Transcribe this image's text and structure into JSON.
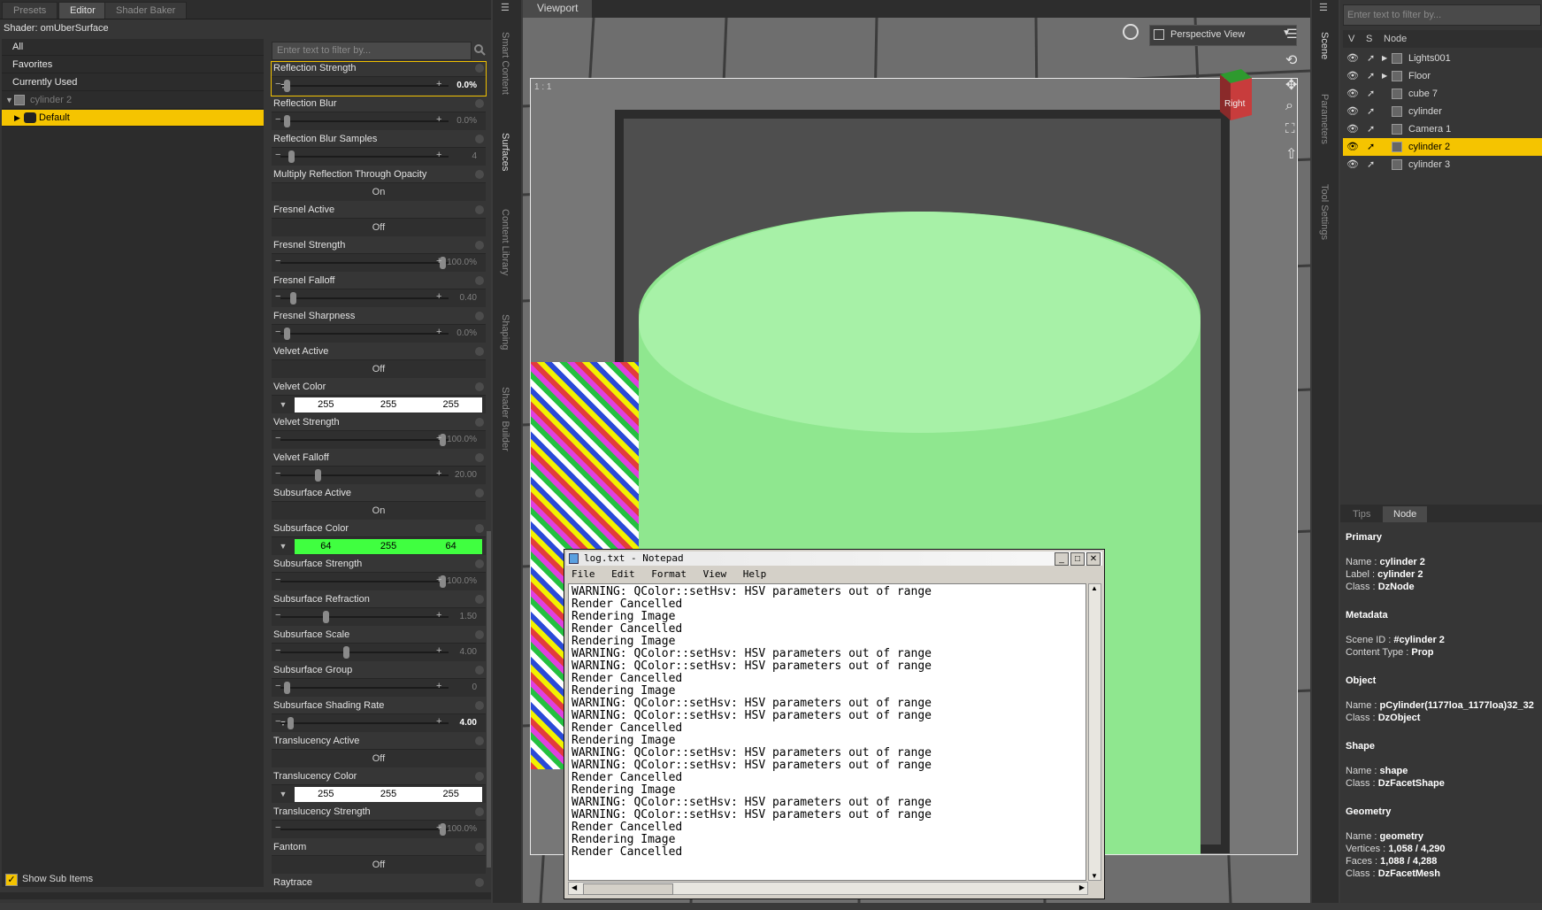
{
  "left_panel": {
    "tabs": [
      "Presets",
      "Editor",
      "Shader Baker"
    ],
    "active_tab": "Editor",
    "shader_label": "Shader: omUberSurface",
    "tree": [
      "All",
      "Favorites",
      "Currently Used",
      "cylinder 2",
      "Default"
    ],
    "filter_placeholder": "Enter text to filter by...",
    "show_sub_items": "Show Sub Items",
    "properties": [
      {
        "name": "Reflection Strength",
        "kind": "slider",
        "value": "0.0%",
        "fraction": 0.0
      },
      {
        "name": "Reflection Blur",
        "kind": "slider",
        "value": "0.0%",
        "fraction": 0.0
      },
      {
        "name": "Reflection Blur Samples",
        "kind": "slider",
        "value": "4",
        "fraction": 0.03
      },
      {
        "name": "Multiply Reflection Through Opacity",
        "kind": "toggle",
        "value": "On"
      },
      {
        "name": "Fresnel Active",
        "kind": "toggle",
        "value": "Off"
      },
      {
        "name": "Fresnel Strength",
        "kind": "slider",
        "value": "100.0%",
        "fraction": 1.0
      },
      {
        "name": "Fresnel Falloff",
        "kind": "slider",
        "value": "0.40",
        "fraction": 0.04
      },
      {
        "name": "Fresnel Sharpness",
        "kind": "slider",
        "value": "0.0%",
        "fraction": 0.0
      },
      {
        "name": "Velvet Active",
        "kind": "toggle",
        "value": "Off"
      },
      {
        "name": "Velvet Color",
        "kind": "color",
        "values": [
          "255",
          "255",
          "255"
        ],
        "color": "#ffffff"
      },
      {
        "name": "Velvet Strength",
        "kind": "slider",
        "value": "100.0%",
        "fraction": 1.0
      },
      {
        "name": "Velvet Falloff",
        "kind": "slider",
        "value": "20.00",
        "fraction": 0.2
      },
      {
        "name": "Subsurface Active",
        "kind": "toggle",
        "value": "On"
      },
      {
        "name": "Subsurface Color",
        "kind": "color",
        "values": [
          "64",
          "255",
          "64"
        ],
        "color": "#40ff40"
      },
      {
        "name": "Subsurface Strength",
        "kind": "slider",
        "value": "100.0%",
        "fraction": 1.0
      },
      {
        "name": "Subsurface Refraction",
        "kind": "slider",
        "value": "1.50",
        "fraction": 0.25
      },
      {
        "name": "Subsurface Scale",
        "kind": "slider",
        "value": "4.00",
        "fraction": 0.38
      },
      {
        "name": "Subsurface Group",
        "kind": "slider",
        "value": "0",
        "fraction": 0.0
      },
      {
        "name": "Subsurface Shading Rate",
        "kind": "slider",
        "value": "4.00",
        "fraction": 0.02
      },
      {
        "name": "Translucency Active",
        "kind": "toggle",
        "value": "Off"
      },
      {
        "name": "Translucency Color",
        "kind": "color",
        "values": [
          "255",
          "255",
          "255"
        ],
        "color": "#ffffff"
      },
      {
        "name": "Translucency Strength",
        "kind": "slider",
        "value": "100.0%",
        "fraction": 1.0
      },
      {
        "name": "Fantom",
        "kind": "toggle",
        "value": "Off"
      },
      {
        "name": "Raytrace",
        "kind": "label"
      }
    ]
  },
  "side_tabs_left": [
    "Smart Content",
    "Surfaces",
    "Content Library",
    "Shaping",
    "Shader Builder"
  ],
  "viewport": {
    "title": "Viewport",
    "view_mode": "Perspective View",
    "ratio_label": "1 : 1",
    "cube_face_label": "Right"
  },
  "notepad": {
    "title": "log.txt - Notepad",
    "menu": [
      "File",
      "Edit",
      "Format",
      "View",
      "Help"
    ],
    "lines": [
      "WARNING: QColor::setHsv: HSV parameters out of range",
      "Render Cancelled",
      "Rendering Image",
      "Render Cancelled",
      "Rendering Image",
      "WARNING: QColor::setHsv: HSV parameters out of range",
      "WARNING: QColor::setHsv: HSV parameters out of range",
      "Render Cancelled",
      "Rendering Image",
      "WARNING: QColor::setHsv: HSV parameters out of range",
      "WARNING: QColor::setHsv: HSV parameters out of range",
      "Render Cancelled",
      "Rendering Image",
      "WARNING: QColor::setHsv: HSV parameters out of range",
      "WARNING: QColor::setHsv: HSV parameters out of range",
      "Render Cancelled",
      "Rendering Image",
      "WARNING: QColor::setHsv: HSV parameters out of range",
      "WARNING: QColor::setHsv: HSV parameters out of range",
      "Render Cancelled",
      "Rendering Image",
      "Render Cancelled"
    ]
  },
  "side_tabs_right": [
    "Scene",
    "Parameters",
    "Tool Settings"
  ],
  "scene": {
    "filter_placeholder": "Enter text to filter by...",
    "columns": [
      "V",
      "S",
      "Node"
    ],
    "nodes": [
      "Lights001",
      "Floor",
      "cube 7",
      "cylinder",
      "Camera 1",
      "cylinder 2",
      "cylinder 3"
    ],
    "selected": "cylinder 2"
  },
  "info": {
    "tabs": [
      "Tips",
      "Node"
    ],
    "active_tab": "Node",
    "sections": [
      {
        "title": "Primary",
        "rows": [
          [
            "Name :",
            "cylinder 2"
          ],
          [
            "Label :",
            "cylinder 2"
          ],
          [
            "Class :",
            "DzNode"
          ]
        ]
      },
      {
        "title": "Metadata",
        "rows": [
          [
            "Scene ID :",
            "#cylinder 2"
          ],
          [
            "Content Type :",
            "Prop"
          ]
        ]
      },
      {
        "title": "Object",
        "rows": [
          [
            "Name :",
            "pCylinder(1177loa_1177loa)32_32"
          ],
          [
            "Class :",
            "DzObject"
          ]
        ]
      },
      {
        "title": "Shape",
        "rows": [
          [
            "Name :",
            "shape"
          ],
          [
            "Class :",
            "DzFacetShape"
          ]
        ]
      },
      {
        "title": "Geometry",
        "rows": [
          [
            "Name :",
            "geometry"
          ],
          [
            "Vertices :",
            "1,058 / 4,290"
          ],
          [
            "Faces :",
            "1,088 / 4,288"
          ],
          [
            "Class :",
            "DzFacetMesh"
          ]
        ]
      }
    ]
  },
  "colors": {
    "accent": "#f5c400",
    "panel": "#363636",
    "subsurface": "#40ff40",
    "cylinder": "#8fe78f"
  }
}
